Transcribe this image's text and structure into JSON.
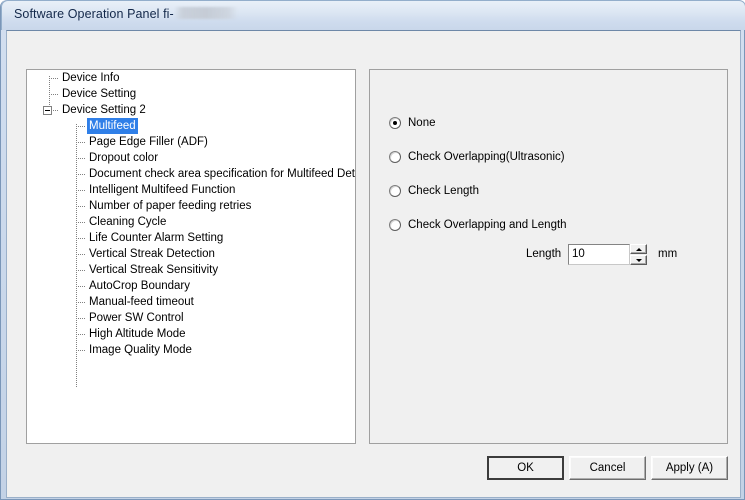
{
  "window": {
    "title_prefix": "Software Operation Panel fi-",
    "title_redacted": true
  },
  "tree": {
    "nodes": [
      {
        "label": "Device Info",
        "level": 1,
        "expander": false,
        "selected": false
      },
      {
        "label": "Device Setting",
        "level": 1,
        "expander": false,
        "selected": false
      },
      {
        "label": "Device Setting 2",
        "level": 1,
        "expander": true,
        "selected": false
      },
      {
        "label": "Multifeed",
        "level": 2,
        "expander": false,
        "selected": true
      },
      {
        "label": "Page Edge Filler (ADF)",
        "level": 2,
        "expander": false,
        "selected": false
      },
      {
        "label": "Dropout color",
        "level": 2,
        "expander": false,
        "selected": false
      },
      {
        "label": "Document check area specification for Multifeed Detection",
        "level": 2,
        "expander": false,
        "selected": false
      },
      {
        "label": "Intelligent Multifeed Function",
        "level": 2,
        "expander": false,
        "selected": false
      },
      {
        "label": "Number of paper feeding retries",
        "level": 2,
        "expander": false,
        "selected": false
      },
      {
        "label": "Cleaning Cycle",
        "level": 2,
        "expander": false,
        "selected": false
      },
      {
        "label": "Life Counter Alarm Setting",
        "level": 2,
        "expander": false,
        "selected": false
      },
      {
        "label": "Vertical Streak Detection",
        "level": 2,
        "expander": false,
        "selected": false
      },
      {
        "label": "Vertical Streak Sensitivity",
        "level": 2,
        "expander": false,
        "selected": false
      },
      {
        "label": "AutoCrop Boundary",
        "level": 2,
        "expander": false,
        "selected": false
      },
      {
        "label": "Manual-feed timeout",
        "level": 2,
        "expander": false,
        "selected": false
      },
      {
        "label": "Power SW Control",
        "level": 2,
        "expander": false,
        "selected": false
      },
      {
        "label": "High Altitude Mode",
        "level": 2,
        "expander": false,
        "selected": false
      },
      {
        "label": "Image Quality Mode",
        "level": 2,
        "expander": false,
        "selected": false
      }
    ]
  },
  "settings": {
    "radios": [
      {
        "label": "None",
        "checked": true
      },
      {
        "label": "Check Overlapping(Ultrasonic)",
        "checked": false
      },
      {
        "label": "Check Length",
        "checked": false
      },
      {
        "label": "Check Overlapping and Length",
        "checked": false
      }
    ],
    "length": {
      "label": "Length",
      "value": "10",
      "unit": "mm"
    }
  },
  "buttons": {
    "ok": "OK",
    "cancel": "Cancel",
    "apply": "Apply (A)"
  },
  "colors": {
    "selection": "#2f7fe8",
    "titlebar": "#cfdcee",
    "dialog_bg": "#f0f0f0"
  }
}
